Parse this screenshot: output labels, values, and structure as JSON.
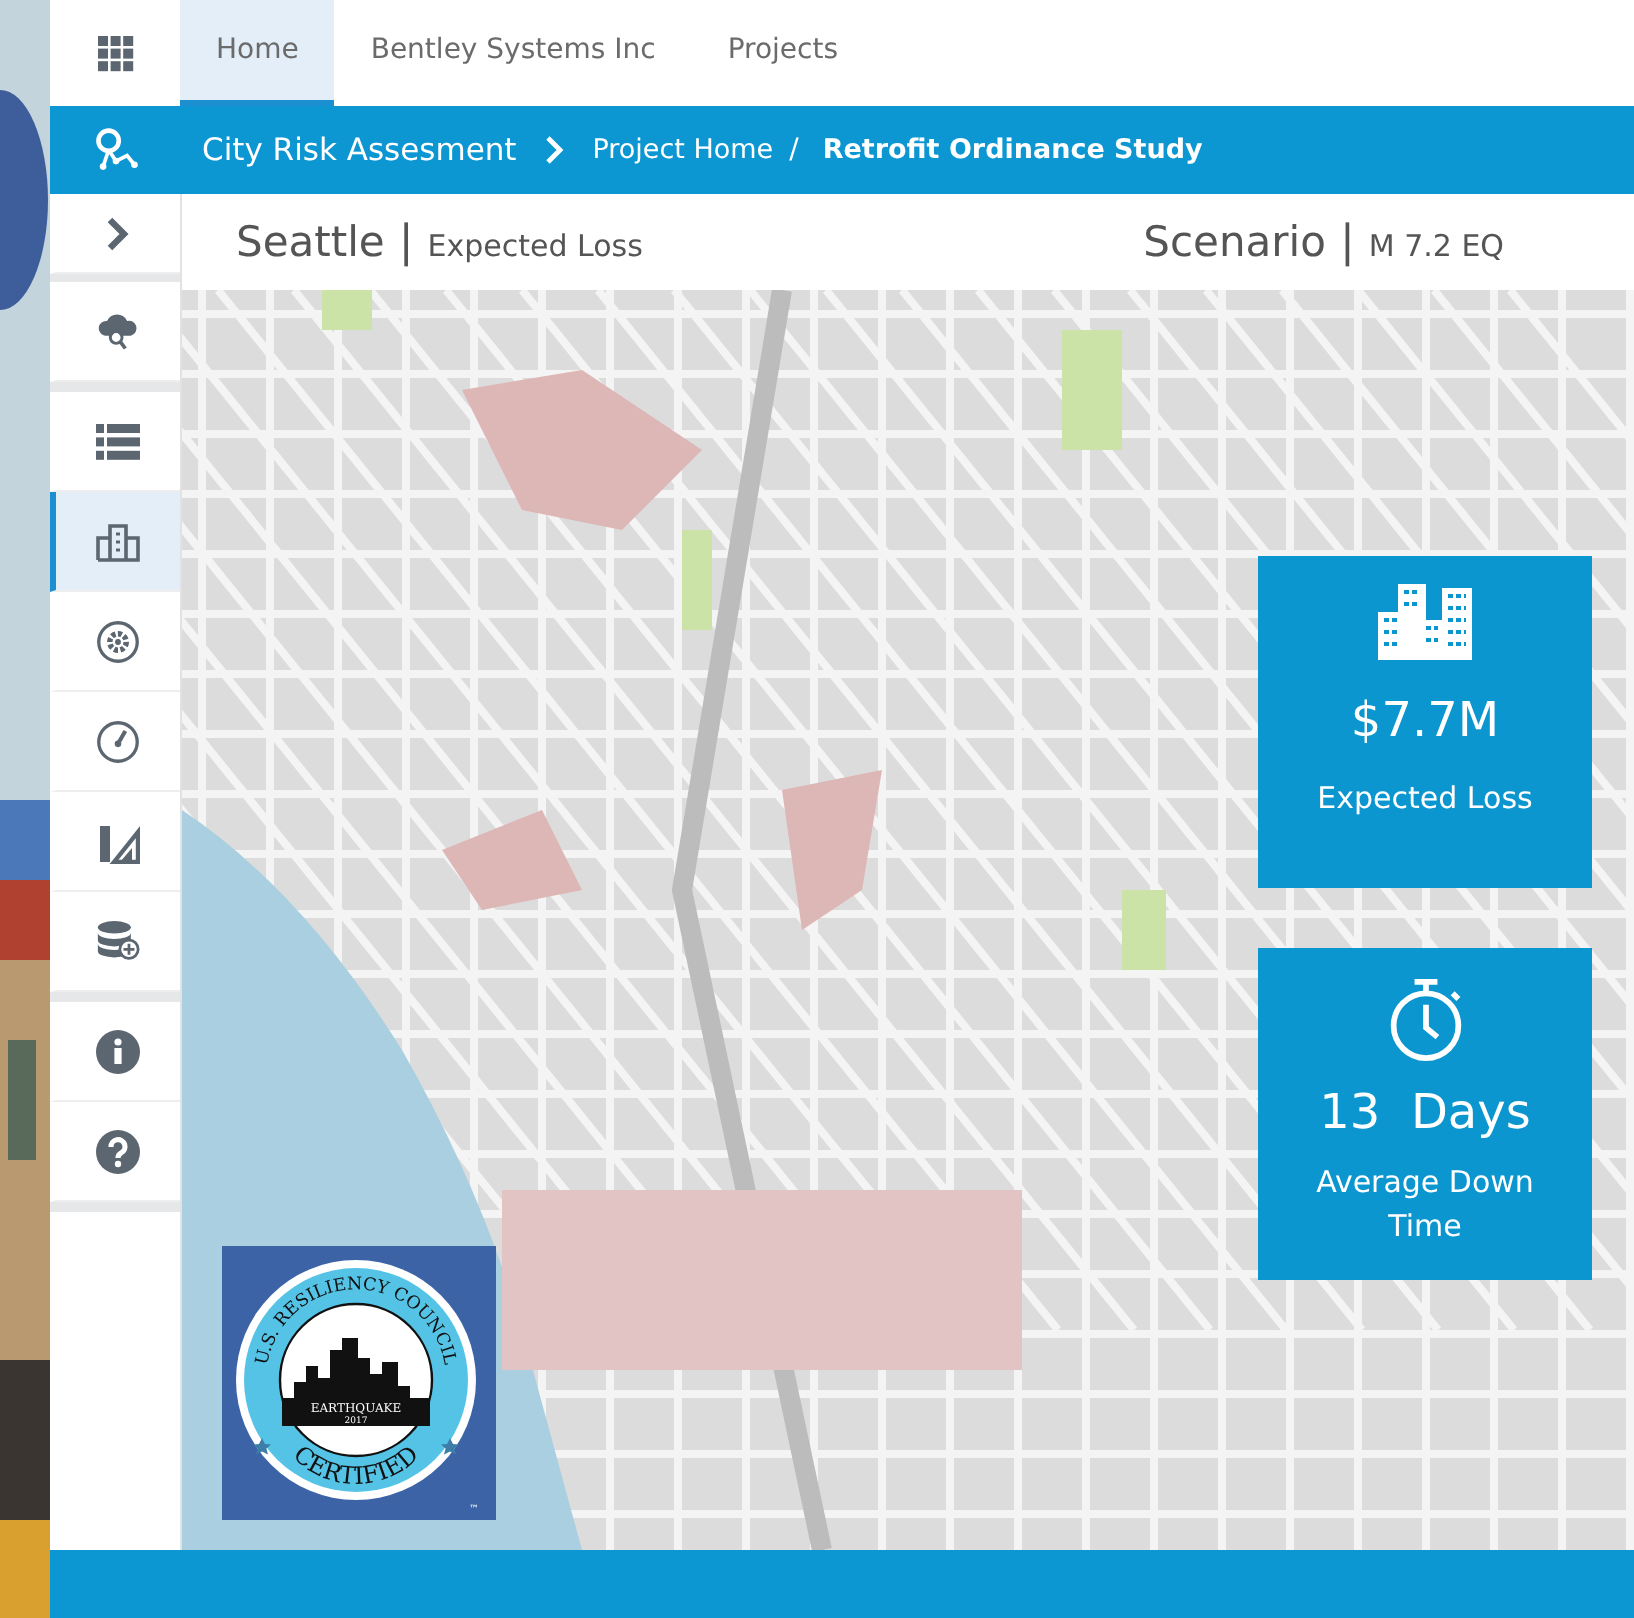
{
  "tabs": [
    {
      "label": "Home",
      "selected": true
    },
    {
      "label": "Bentley Systems Inc",
      "selected": false
    },
    {
      "label": "Projects",
      "selected": false
    }
  ],
  "breadcrumb": {
    "app_title": "City Risk Assesment",
    "separator": "/",
    "items": [
      {
        "label": "Project Home",
        "current": false
      },
      {
        "label": "Retrofit Ordinance Study",
        "current": true
      }
    ]
  },
  "sidebar": {
    "groups": [
      [
        {
          "kind": "expand",
          "selected": false
        }
      ],
      [
        {
          "kind": "cloud-search",
          "selected": false
        }
      ],
      [
        {
          "kind": "list",
          "selected": false
        },
        {
          "kind": "buildings",
          "selected": true
        },
        {
          "kind": "gear",
          "selected": false
        },
        {
          "kind": "gauge",
          "selected": false
        },
        {
          "kind": "ruler",
          "selected": false
        },
        {
          "kind": "database",
          "selected": false
        }
      ],
      [
        {
          "kind": "info",
          "selected": false
        },
        {
          "kind": "help",
          "selected": false
        }
      ]
    ]
  },
  "header": {
    "city": "Seattle",
    "divider": "|",
    "scenario_divider": "|",
    "metric": "Expected Loss",
    "scenario_label": "Scenario",
    "scenario": "M 7.2 EQ"
  },
  "cards": [
    {
      "kind": "loss",
      "value": "$7.7M",
      "label": "Expected Loss"
    },
    {
      "kind": "downtime",
      "value": "13  Days",
      "label": "Average Down Time"
    }
  ],
  "badge": {
    "top": "U.S. RESILIENCY COUNCIL",
    "hazard": "EARTHQUAKE",
    "year": "2017",
    "bottom": "CERTIFIED",
    "mark": "™"
  }
}
